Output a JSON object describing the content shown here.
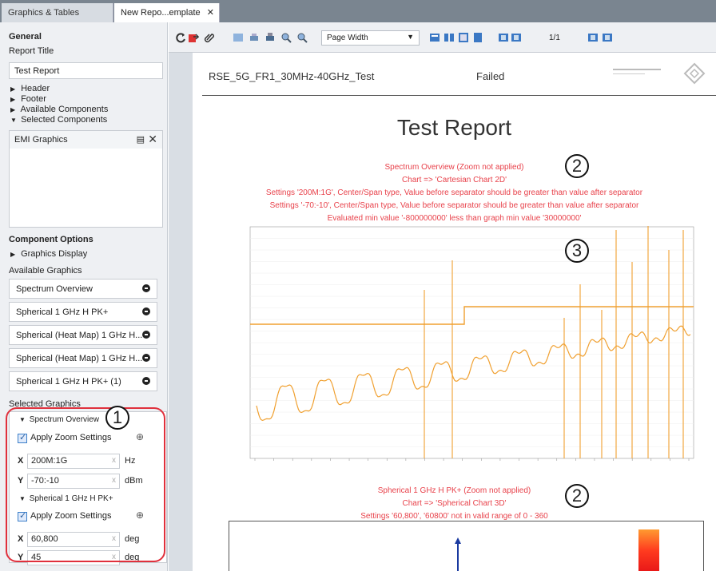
{
  "tabs": [
    {
      "label": "Graphics & Tables"
    },
    {
      "label": "New Repo...emplate",
      "close": "✕"
    }
  ],
  "left": {
    "general": "General",
    "report_title_label": "Report Title",
    "report_title_value": "Test Report",
    "tree": [
      {
        "label": "Header",
        "expanded": false
      },
      {
        "label": "Footer",
        "expanded": false
      },
      {
        "label": "Available Components",
        "expanded": false
      },
      {
        "label": "Selected Components",
        "expanded": true
      }
    ],
    "selected_component": "EMI Graphics",
    "component_options": "Component Options",
    "graphics_display": "Graphics Display",
    "available_graphics_label": "Available Graphics",
    "available_graphics": [
      "Spectrum Overview",
      "Spherical 1 GHz H PK+",
      "Spherical (Heat Map) 1 GHz H...",
      "Spherical (Heat Map) 1 GHz H...",
      "Spherical 1 GHz H PK+ (1)"
    ],
    "selected_graphics_label": "Selected Graphics",
    "selected_graphics": [
      {
        "name": "Spectrum Overview",
        "apply_zoom": "Apply Zoom Settings",
        "x_value": "200M:1G",
        "x_unit": "Hz",
        "y_value": "-70:-10",
        "y_unit": "dBm"
      },
      {
        "name": "Spherical 1 GHz H PK+",
        "apply_zoom": "Apply Zoom Settings",
        "x_value": "60,800",
        "x_unit": "deg",
        "y_value": "45",
        "y_unit": "deg"
      }
    ],
    "x_label": "X",
    "y_label": "Y",
    "clear": "x",
    "callout_1": "1"
  },
  "toolbar": {
    "zoom_mode": "Page Width",
    "page_count": "1/1"
  },
  "report": {
    "header_title": "RSE_5G_FR1_30MHz-40GHz_Test",
    "header_status": "Failed",
    "title": "Test Report",
    "errors_1": [
      "Spectrum Overview (Zoom not applied)",
      "Chart => 'Cartesian Chart 2D'",
      "Settings '200M:1G', Center/Span type, Value before separator should be greater than value after separator",
      "Settings '-70:-10', Center/Span type, Value before separator should be greater than value after separator",
      "Evaluated min value '-800000000' less than graph min value '30000000'"
    ],
    "errors_2": [
      "Spherical 1 GHz H PK+ (Zoom not applied)",
      "Chart => 'Spherical Chart 3D'",
      "Settings '60,800', '60800' not in valid range of 0 - 360"
    ],
    "callout_2": "2",
    "callout_3": "3"
  },
  "colors": {
    "error_text": "#e8424b",
    "trace": "#f0a030",
    "limit_line": "#f0a030",
    "callout_frame": "#e0303c"
  }
}
